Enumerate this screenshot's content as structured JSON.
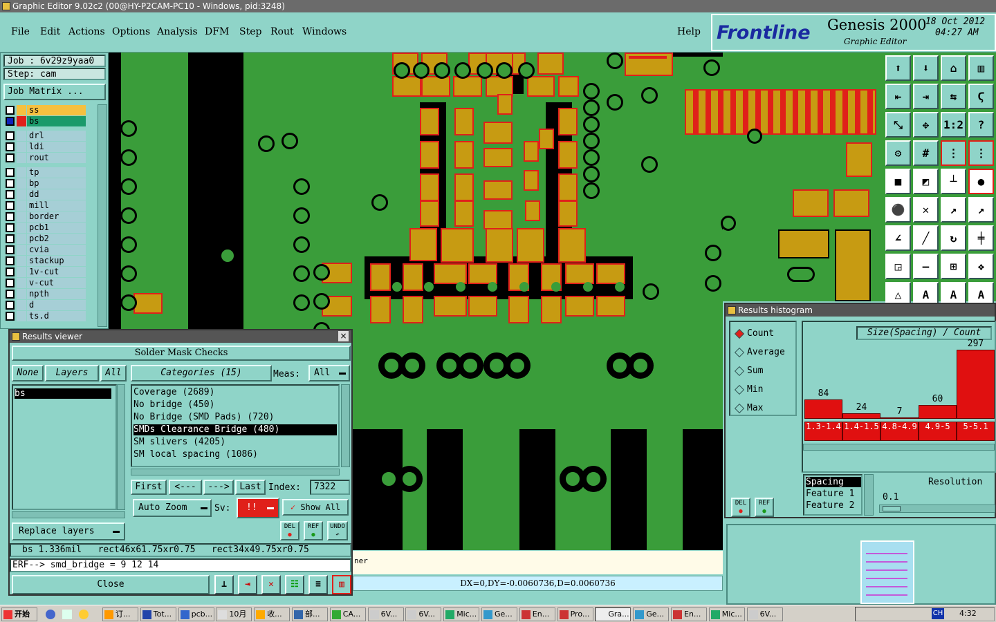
{
  "window": {
    "title": "Graphic Editor 9.02c2 (00@HY-P2CAM-PC10 - Windows, pid:3248)"
  },
  "menu": [
    "File",
    "Edit",
    "Actions",
    "Options",
    "Analysis",
    "DFM",
    "Step",
    "Rout",
    "Windows"
  ],
  "help": "Help",
  "brand": {
    "logo": "Frontline",
    "product": "Genesis 2000",
    "subtitle": "Graphic Editor",
    "date": "18 Oct 2012",
    "time": "04:27 AM"
  },
  "job": {
    "job_label": "Job : 6v29z9yaa0",
    "step_label": "Step: cam",
    "matrix_button": "Job Matrix ..."
  },
  "layers": [
    "ss",
    "bs",
    "drl",
    "ldi",
    "rout",
    "tp",
    "bp",
    "dd",
    "mill",
    "border",
    "pcb1",
    "pcb2",
    "cvia",
    "stackup",
    "1v-cut",
    "v-cut",
    "npth",
    "d",
    "ts.d"
  ],
  "results_viewer": {
    "title": "Results viewer",
    "header": "Solder Mask Checks",
    "none_btn": "None",
    "layers_btn": "Layers",
    "all_btn": "All",
    "categories_btn": "Categories (15)",
    "meas_label": "Meas:",
    "meas_value": "All",
    "layer_items": [
      "bs"
    ],
    "categories": [
      "Coverage (2689)",
      "No bridge (450)",
      "No Bridge (SMD Pads) (720)",
      "SMDs Clearance Bridge (480)",
      "SM slivers (4205)",
      "SM local spacing (1086)"
    ],
    "nav": {
      "first": "First",
      "prev": "<---",
      "next": "--->",
      "last": "Last",
      "index_label": "Index:",
      "index_value": "7322"
    },
    "auto_zoom": "Auto Zoom",
    "sv_label": "Sv:",
    "sv_value": "!!",
    "show_all": "Show All",
    "replace_layers": "Replace layers",
    "del": "DEL",
    "ref": "REF",
    "undo": "UNDO",
    "status": "bs 1.336mil   rect46x61.75xr0.75   rect34x49.75xr0.75",
    "erf": "ERF--> smd_bridge = 9 12 14",
    "close": "Close"
  },
  "coords": "DX=0,DY=-0.0060736,D=0.0060736",
  "hidden_text": "ner",
  "histogram": {
    "title": "Results histogram",
    "modes": [
      "Count",
      "Average",
      "Sum",
      "Min",
      "Max"
    ],
    "selected_mode": "Count",
    "axis_title": "Size(Spacing) / Count",
    "spacing_items": [
      "Spacing",
      "Feature 1",
      "Feature 2"
    ],
    "resolution_label": "Resolution",
    "resolution_value": "0.1",
    "del": "DEL",
    "ref": "REF"
  },
  "chart_data": {
    "type": "bar",
    "title": "Size(Spacing) / Count",
    "categories": [
      "1.3-1.4",
      "1.4-1.5",
      "4.8-4.9",
      "4.9-5",
      "5-5.1"
    ],
    "values": [
      84,
      24,
      7,
      60,
      297
    ],
    "value_labels": [
      "84",
      "24",
      "7",
      "60",
      "297"
    ],
    "ylim": [
      0,
      297
    ],
    "colors": {
      "bar": "#e01010"
    }
  },
  "taskbar": {
    "start": "开始",
    "items": [
      "订...",
      "Tot...",
      "pcb...",
      "10月",
      "收...",
      "部...",
      "CA...",
      "6V...",
      "6V...",
      "Mic...",
      "Ge...",
      "En...",
      "Pro...",
      "Gra...",
      "Ge...",
      "En...",
      "Mic...",
      "6V..."
    ],
    "clock": "4:32",
    "ch": "CH"
  }
}
